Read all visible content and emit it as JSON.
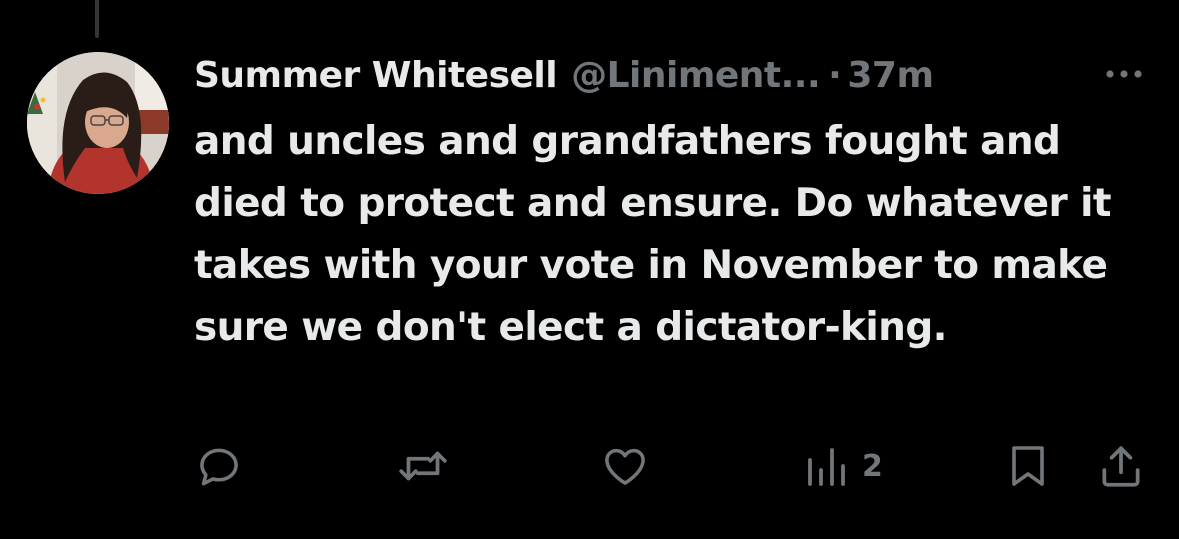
{
  "tweet": {
    "display_name": "Summer Whitesell",
    "handle": "@Liniment...",
    "separator": "·",
    "timestamp": "37m",
    "text": "and uncles and grandfathers fought and died to protect and ensure. Do whatever it takes with your vote in November to make sure we don't elect a dictator-king.",
    "avatar_icon": "profile-photo"
  },
  "actions": {
    "reply_icon": "reply-icon",
    "retweet_icon": "retweet-icon",
    "like_icon": "heart-icon",
    "views_icon": "views-chart-icon",
    "views_count": "2",
    "bookmark_icon": "bookmark-icon",
    "share_icon": "share-icon",
    "more_icon": "more-icon"
  },
  "colors": {
    "background": "#000000",
    "primary_text": "#e7e9ea",
    "secondary_text": "#71767b",
    "thread_line": "#333639"
  }
}
